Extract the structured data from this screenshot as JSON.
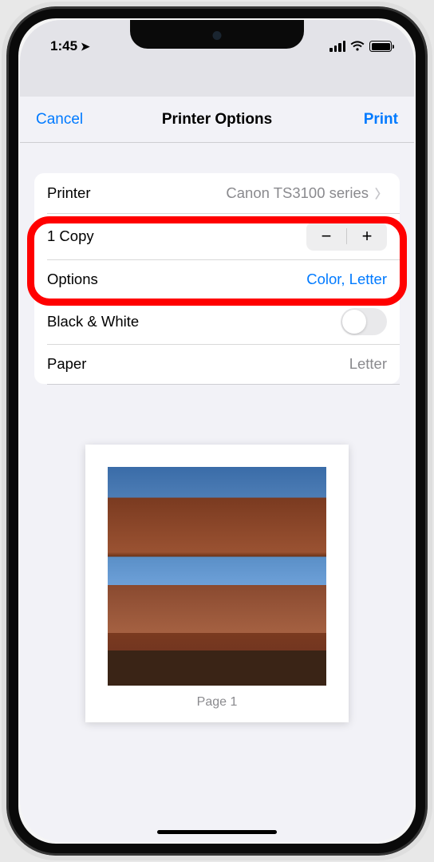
{
  "status": {
    "time": "1:45",
    "location_glyph": "➤"
  },
  "nav": {
    "cancel": "Cancel",
    "title": "Printer Options",
    "print": "Print"
  },
  "rows": {
    "printer_label": "Printer",
    "printer_value": "Canon TS3100 series",
    "copies_label": "1 Copy",
    "options_label": "Options",
    "options_value": "Color, Letter",
    "bw_label": "Black & White",
    "paper_label": "Paper",
    "paper_value": "Letter"
  },
  "stepper": {
    "minus": "−",
    "plus": "+"
  },
  "preview": {
    "page_label": "Page 1"
  }
}
